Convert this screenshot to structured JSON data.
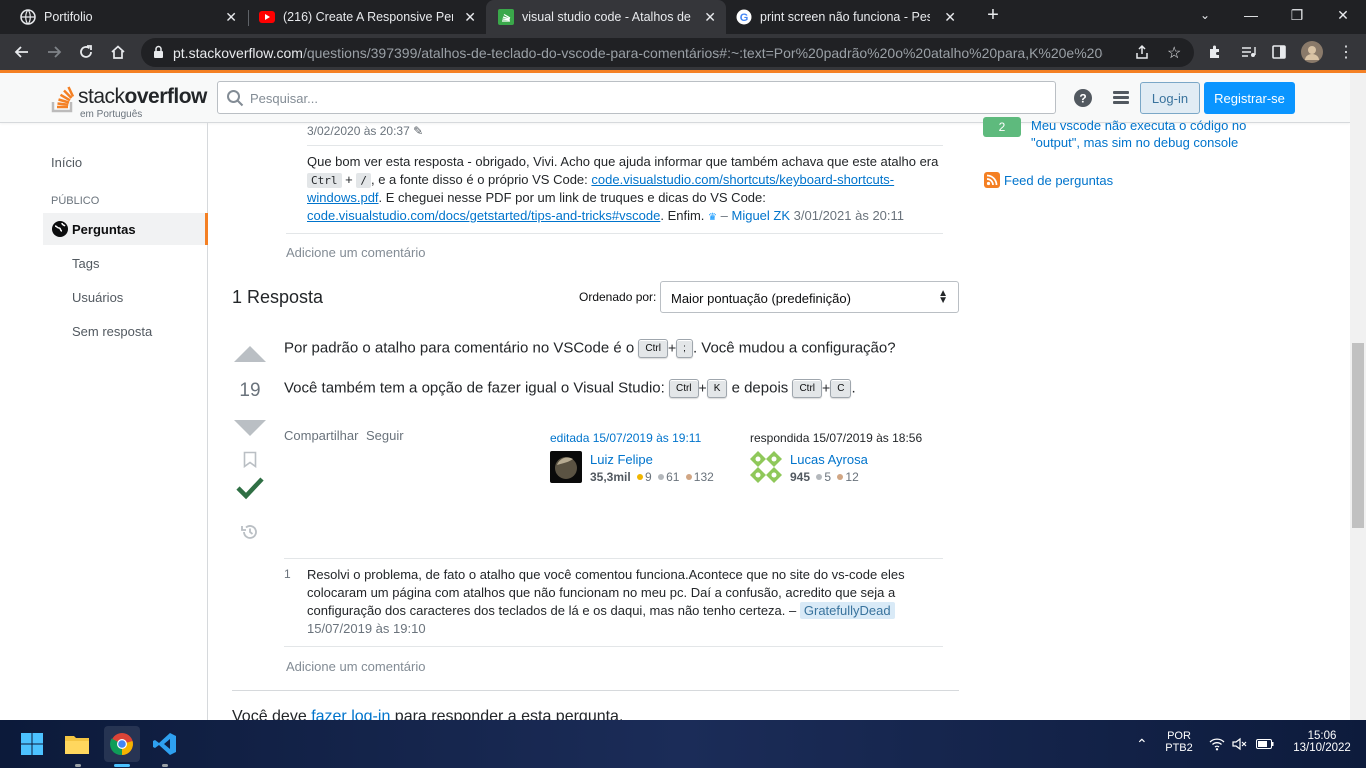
{
  "browser": {
    "tabs": [
      {
        "title": "Portifolio"
      },
      {
        "title": "(216) Create A Responsive Persor"
      },
      {
        "title": "visual studio code - Atalhos de te"
      },
      {
        "title": "print screen não funciona - Pesqu"
      }
    ],
    "url_host": "pt.stackoverflow.com",
    "url_path": "/questions/397399/atalhos-de-teclado-do-vscode-para-comentários#:~:text=Por%20padrão%20o%20atalho%20para,K%20e%20d..."
  },
  "header": {
    "logo_word_light": "stack",
    "logo_word_bold": "overflow",
    "logo_sub": "em Português",
    "search_placeholder": "Pesquisar...",
    "login_label": "Log-in",
    "signup_label": "Registrar-se"
  },
  "leftnav": {
    "home": "Início",
    "public": "PÚBLICO",
    "questions": "Perguntas",
    "tags": "Tags",
    "users": "Usuários",
    "unanswered": "Sem resposta"
  },
  "question": {
    "edit_date": "3/02/2020 às 20:37",
    "comment": {
      "part1": "Que bom ver esta resposta - obrigado, Vivi. Acho que ajuda informar que também achava que este atalho era",
      "key1": "Ctrl",
      "plus": "+",
      "key2": "/",
      "part2": ", e a fonte disso é o próprio VS Code: ",
      "link1a": "code.visualstudio.com/shortcuts/keyboard-shortcuts-",
      "link1b": "windows.pdf",
      "part3": ". E cheguei nesse PDF por um link de truques e dicas do VS Code:",
      "link2": "code.visualstudio.com/docs/getstarted/tips-and-tricks#vscode",
      "part4": ". Enfim.",
      "dash": "–",
      "author": "Miguel ZK",
      "date": "3/01/2021 às 20:11"
    },
    "add_comment": "Adicione um comentário"
  },
  "answers": {
    "count_label": "1 Resposta",
    "sort_label": "Ordenado por:",
    "sort_value": "Maior pontuação (predefinição)"
  },
  "answer": {
    "votes": "19",
    "line1_pre": "Por padrão o atalho para comentário no VSCode é o",
    "line1_key1": "Ctrl",
    "line1_plus": "+",
    "line1_key2": ";",
    "line1_post": ". Você mudou a configuração?",
    "line2_pre": "Você também tem a opção de fazer igual o Visual Studio:",
    "line2_key1": "Ctrl",
    "line2_plus1": "+",
    "line2_key2": "K",
    "line2_mid": "e depois",
    "line2_key3": "Ctrl",
    "line2_plus2": "+",
    "line2_key4": "C",
    "line2_post": ".",
    "share": "Compartilhar",
    "follow": "Seguir",
    "edited_label": "editada 15/07/2019 às 19:11",
    "editor_name": "Luiz Felipe",
    "editor_rep": "35,3mil",
    "editor_gold": "9",
    "editor_silver": "61",
    "editor_bronze": "132",
    "answered_label": "respondida 15/07/2019 às 18:56",
    "author_name": "Lucas Ayrosa",
    "author_rep": "945",
    "author_silver": "5",
    "author_bronze": "12",
    "comment_score": "1",
    "comment_text": "Resolvi o problema, de fato o atalho que você comentou funciona.Acontece que no site do vs-code eles colocaram um página com atalhos que não funcionam no meu pc. Daí a confusão, acredito que seja a configuração dos caracteres dos teclados de lá e os daqui, mas não tenho certeza. –",
    "comment_author": "GratefullyDead",
    "comment_date": "15/07/2019 às 19:10",
    "add_comment": "Adicione um comentário"
  },
  "footer_note": {
    "pre": "Você deve",
    "link": "fazer log-in",
    "post": "para responder a esta pergunta."
  },
  "sidebar": {
    "related_score": "2",
    "related_title": "Meu vscode não executa o código no \"output\", mas sim no debug console",
    "feed": "Feed de perguntas"
  },
  "taskbar": {
    "lang1": "POR",
    "lang2": "PTB2",
    "time": "15:06",
    "date": "13/10/2022"
  },
  "colors": {
    "accent": "#f48024",
    "link": "#0074cc",
    "accepted": "#2f6f44",
    "primary_button": "#0a95ff"
  }
}
